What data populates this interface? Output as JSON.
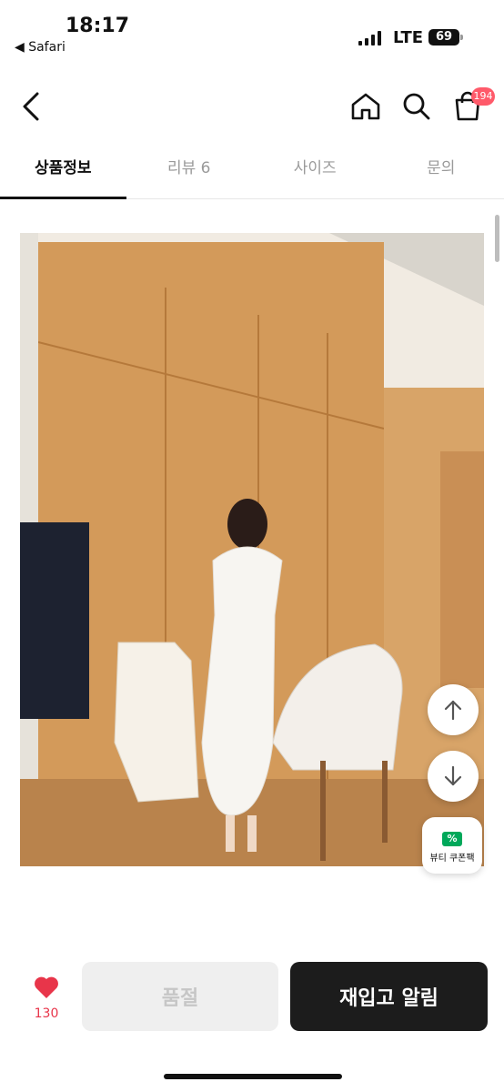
{
  "status": {
    "time": "18:17",
    "back_app": "◀ Safari",
    "network": "LTE",
    "battery": "69"
  },
  "header": {
    "cart_count": "194"
  },
  "tabs": [
    {
      "label": "상품정보",
      "active": true
    },
    {
      "label": "리뷰 6",
      "active": false
    },
    {
      "label": "사이즈",
      "active": false
    },
    {
      "label": "문의",
      "active": false
    }
  ],
  "floating": {
    "coupon_label": "뷰티 쿠폰팩",
    "coupon_icon": "%"
  },
  "bottom": {
    "like_count": "130",
    "soldout_label": "품절",
    "restock_label": "재입고 알림"
  },
  "colors": {
    "accent": "#e8354a",
    "badge": "#ff5a6a",
    "coupon": "#00a85a",
    "dark_button": "#1c1c1c"
  }
}
